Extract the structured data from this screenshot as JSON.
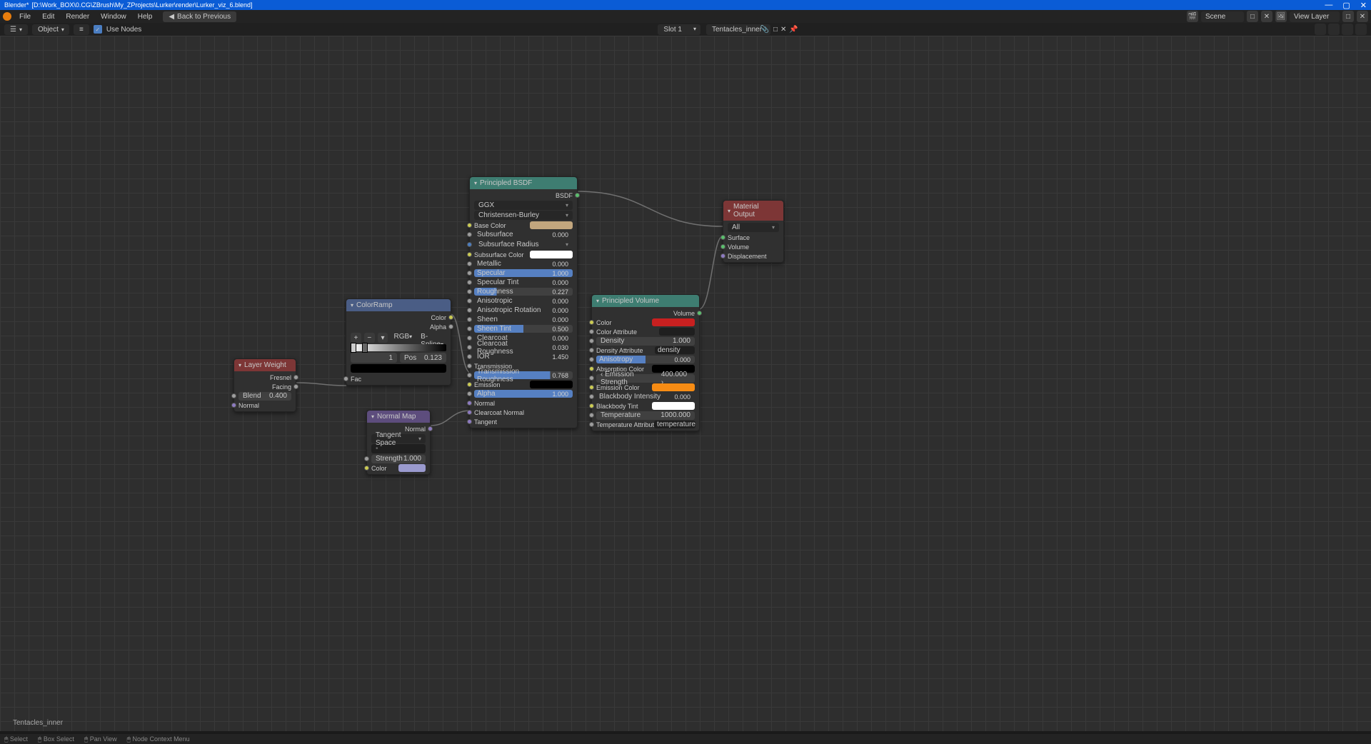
{
  "titlebar": {
    "app": "Blender*",
    "file": "[D:\\Work_BOX\\0.CG\\ZBrush\\My_ZProjects\\Lurker\\render\\Lurker_viz_6.blend]"
  },
  "menu": {
    "file": "File",
    "edit": "Edit",
    "render": "Render",
    "window": "Window",
    "help": "Help",
    "back": "Back to Previous",
    "scene_label": "Scene",
    "scene": "Scene",
    "viewlayer_label": "View Layer",
    "viewlayer": "View Layer"
  },
  "toolbar": {
    "mode": "Object",
    "use_nodes": "Use Nodes",
    "slot": "Slot 1",
    "material": "Tentacles_inner"
  },
  "breadcrumb": "Tentacles_inner",
  "nodes": {
    "layer_weight": {
      "title": "Layer Weight",
      "fresnel": "Fresnel",
      "facing": "Facing",
      "blend_label": "Blend",
      "blend_val": "0.400",
      "normal": "Normal"
    },
    "color_ramp": {
      "title": "ColorRamp",
      "color": "Color",
      "alpha": "Alpha",
      "mode": "RGB",
      "interp": "B-Spline",
      "stop_idx": "1",
      "pos_label": "Pos",
      "pos_val": "0.123",
      "fac": "Fac"
    },
    "normal_map": {
      "title": "Normal Map",
      "normal_out": "Normal",
      "space": "Tangent Space",
      "strength_label": "Strength",
      "strength_val": "1.000",
      "color": "Color",
      "color_hex": "#9a9ace"
    },
    "bsdf": {
      "title": "Principled BSDF",
      "bsdf_out": "BSDF",
      "dist": "GGX",
      "sss": "Christensen-Burley",
      "base_color": "Base Color",
      "base_color_hex": "#c2a67e",
      "subsurface": "Subsurface",
      "subsurface_val": "0.000",
      "subsurface_radius": "Subsurface Radius",
      "subsurface_color": "Subsurface Color",
      "subsurface_color_hex": "#ffffff",
      "metallic": "Metallic",
      "metallic_val": "0.000",
      "specular": "Specular",
      "specular_val": "1.000",
      "specular_tint": "Specular Tint",
      "specular_tint_val": "0.000",
      "roughness": "Roughness",
      "roughness_val": "0.227",
      "anisotropic": "Anisotropic",
      "anisotropic_val": "0.000",
      "anisotropic_rot": "Anisotropic Rotation",
      "anisotropic_rot_val": "0.000",
      "sheen": "Sheen",
      "sheen_val": "0.000",
      "sheen_tint": "Sheen Tint",
      "sheen_tint_val": "0.500",
      "clearcoat": "Clearcoat",
      "clearcoat_val": "0.000",
      "clearcoat_rough": "Clearcoat Roughness",
      "clearcoat_rough_val": "0.030",
      "ior": "IOR",
      "ior_val": "1.450",
      "transmission": "Transmission",
      "transmission_rough": "Transmission Roughness",
      "transmission_rough_val": "0.768",
      "emission": "Emission",
      "emission_hex": "#000000",
      "alpha": "Alpha",
      "alpha_val": "1.000",
      "normal": "Normal",
      "clearcoat_normal": "Clearcoat Normal",
      "tangent": "Tangent"
    },
    "volume": {
      "title": "Principled Volume",
      "vol_out": "Volume",
      "color": "Color",
      "color_hex": "#c82020",
      "color_attr": "Color Attribute",
      "density": "Density",
      "density_val": "1.000",
      "density_attr": "Density Attribute",
      "density_attr_val": "density",
      "anisotropy": "Anisotropy",
      "anisotropy_val": "0.000",
      "absorption": "Absorption Color",
      "absorption_hex": "#000000",
      "emission_str": "Emission Strength",
      "emission_str_val": "400.000",
      "emission_col": "Emission Color",
      "emission_col_hex": "#f78c14",
      "blackbody_int": "Blackbody Intensity",
      "blackbody_int_val": "0.000",
      "blackbody_tint": "Blackbody Tint",
      "blackbody_tint_hex": "#ffffff",
      "temperature": "Temperature",
      "temperature_val": "1000.000",
      "temp_attr": "Temperature Attribut",
      "temp_attr_val": "temperature"
    },
    "output": {
      "title": "Material Output",
      "target": "All",
      "surface": "Surface",
      "volume": "Volume",
      "displacement": "Displacement"
    }
  },
  "footer": {
    "select": "Select",
    "box": "Box Select",
    "view": "Pan View",
    "context": "Node Context Menu"
  }
}
